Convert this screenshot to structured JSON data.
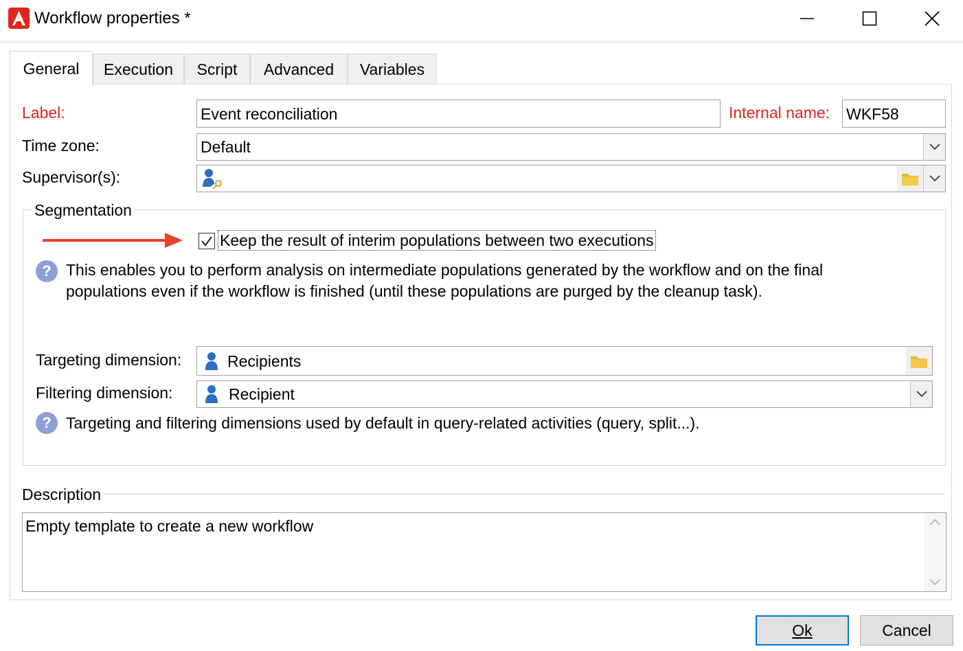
{
  "window": {
    "title": "Workflow properties *"
  },
  "tabs": [
    {
      "label": "General",
      "active": true
    },
    {
      "label": "Execution",
      "active": false
    },
    {
      "label": "Script",
      "active": false
    },
    {
      "label": "Advanced",
      "active": false
    },
    {
      "label": "Variables",
      "active": false
    }
  ],
  "general": {
    "label_caption": "Label:",
    "label_value": "Event reconciliation",
    "internal_name_caption": "Internal name:",
    "internal_name_value": "WKF58",
    "timezone_caption": "Time zone:",
    "timezone_value": "Default",
    "supervisors_caption": "Supervisor(s):",
    "supervisors_value": ""
  },
  "segmentation": {
    "title": "Segmentation",
    "keep_result_label": "Keep the result of interim populations between two executions",
    "keep_result_checked": true,
    "help_text_line1": "This enables you to perform analysis on intermediate populations generated by the workflow and on the final",
    "help_text_line2": "populations even if the workflow is finished (until these populations are purged by the cleanup task).",
    "targeting_caption": "Targeting dimension:",
    "targeting_value": "Recipients",
    "filtering_caption": "Filtering dimension:",
    "filtering_value": "Recipient",
    "dimensions_help": "Targeting and filtering dimensions used by default in query-related activities (query, split...)."
  },
  "description": {
    "title": "Description",
    "value": "Empty template to create a new workflow"
  },
  "buttons": {
    "ok_label": "Ok",
    "cancel_label": "Cancel"
  },
  "icons": {
    "app": "adobe-campaign-icon",
    "minimize": "minimize-icon",
    "maximize": "maximize-icon",
    "close": "close-icon",
    "dropdown": "chevron-down-icon",
    "folder": "folder-icon",
    "person": "person-icon",
    "supervisor": "operator-icon",
    "help": "question-icon",
    "arrow": "red-arrow-icon"
  },
  "colors": {
    "required_label": "#e0251c",
    "help_icon": "#8e9fd6",
    "folder": "#e8b83a",
    "person": "#2e6ec2",
    "arrow": "#e8412c",
    "default_button_border": "#0078d7"
  }
}
